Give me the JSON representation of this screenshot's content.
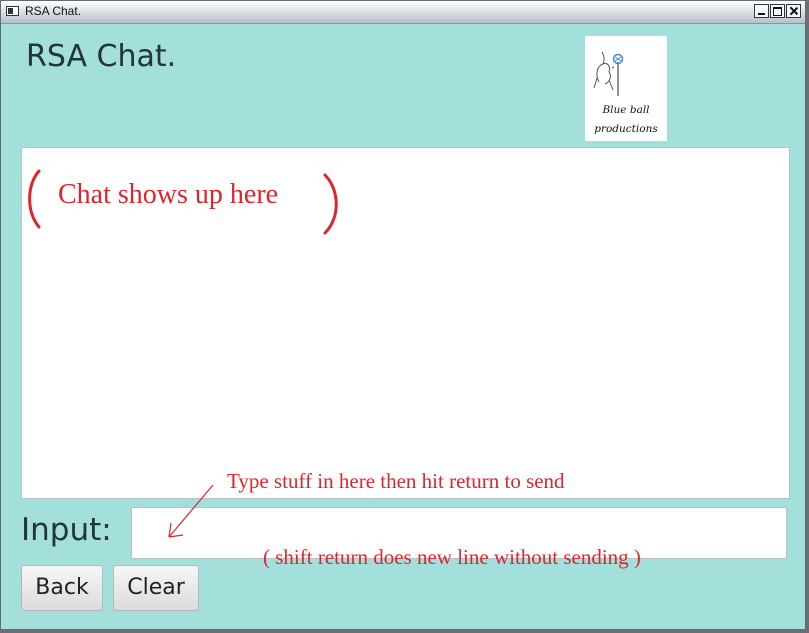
{
  "window": {
    "title": "RSA Chat.",
    "controls": {
      "minimize_icon": "minimize-icon",
      "maximize_icon": "maximize-icon",
      "close_icon": "close-icon"
    }
  },
  "header": {
    "title": "RSA Chat."
  },
  "logo": {
    "line1": "Blue ball",
    "line2": "productions"
  },
  "chat": {
    "placeholder_annotation": "Chat shows up here"
  },
  "input": {
    "label": "Input:",
    "value": "",
    "annotation_type": "Type stuff in here then hit return to send",
    "annotation_shift": "( shift return does new line without sending )"
  },
  "buttons": {
    "back": "Back",
    "clear": "Clear"
  },
  "colors": {
    "background": "#a3e0dc",
    "annotation": "#e0242c",
    "text": "#24343c"
  }
}
